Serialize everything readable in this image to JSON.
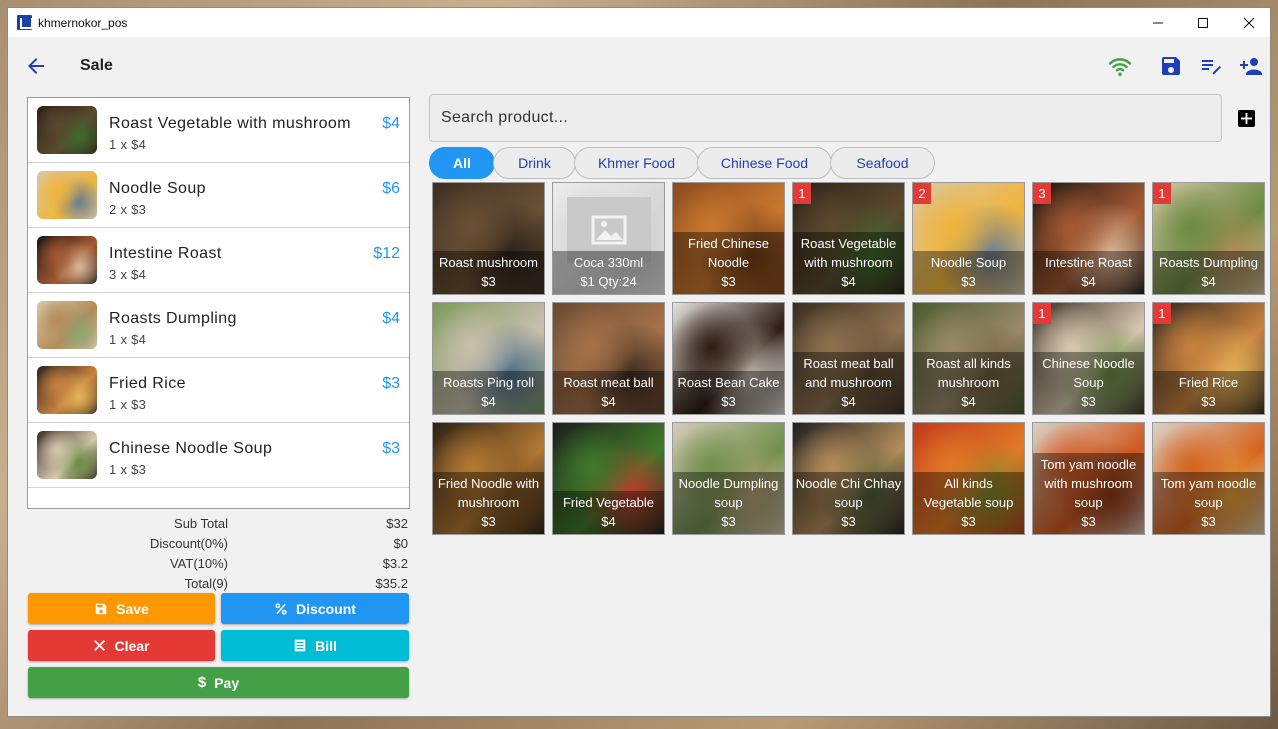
{
  "window": {
    "title": "khmernokor_pos"
  },
  "appbar": {
    "title": "Sale"
  },
  "cart": [
    {
      "name": "Roast Vegetable with mushroom",
      "qty": "1 x $4",
      "total": "$4",
      "colors": [
        "#2b2117",
        "#5c4a2e",
        "#3c6b2d"
      ]
    },
    {
      "name": "Noodle Soup",
      "qty": "2 x $3",
      "total": "$6",
      "colors": [
        "#d8c9a9",
        "#f0b43a",
        "#6a7e8f"
      ]
    },
    {
      "name": "Intestine Roast",
      "qty": "3 x $4",
      "total": "$12",
      "colors": [
        "#181412",
        "#a65a32",
        "#d9b89a"
      ]
    },
    {
      "name": "Roasts Dumpling",
      "qty": "1 x $4",
      "total": "$4",
      "colors": [
        "#d8c7a6",
        "#b48a5a",
        "#89a66c"
      ]
    },
    {
      "name": "Fried Rice",
      "qty": "1 x $3",
      "total": "$3",
      "colors": [
        "#2a2520",
        "#c9823e",
        "#e6b55a"
      ]
    },
    {
      "name": "Chinese Noodle Soup",
      "qty": "1 x $3",
      "total": "$3",
      "colors": [
        "#3a2d22",
        "#d7c9b0",
        "#6a8d43"
      ]
    }
  ],
  "summary": {
    "subtotal_label": "Sub Total",
    "subtotal": "$32",
    "discount_label": "Discount(0%)",
    "discount": "$0",
    "vat_label": "VAT(10%)",
    "vat": "$3.2",
    "total_label": "Total(9)",
    "total": "$35.2"
  },
  "buttons": {
    "save": "Save",
    "discount": "Discount",
    "clear": "Clear",
    "bill": "Bill",
    "pay": "Pay"
  },
  "colors": {
    "save": "#ff9800",
    "discount": "#2196f3",
    "clear": "#e53935",
    "bill": "#00bcd4",
    "pay": "#43a047",
    "accent": "#2196f3",
    "icon_blue": "#1e3fb5",
    "wifi": "#43a047"
  },
  "search": {
    "placeholder": "Search product..."
  },
  "categories": [
    "All",
    "Drink",
    "Khmer Food",
    "Chinese Food",
    "Seafood"
  ],
  "active_category": "All",
  "products": [
    {
      "name": "Roast mushroom",
      "price": "$3",
      "badge": "",
      "colors": [
        "#3d2f22",
        "#6a5034",
        "#2a2119"
      ]
    },
    {
      "name": "Coca 330ml",
      "price": "$1 Qty:24",
      "badge": "",
      "placeholder": true,
      "colors": [
        "#ececec",
        "#d6d6d6",
        "#c9c9c9"
      ]
    },
    {
      "name": "Fried Chinese Noodle",
      "price": "$3",
      "badge": "",
      "colors": [
        "#8a4a1f",
        "#c9782f",
        "#6b3a16"
      ]
    },
    {
      "name": "Roast Vegetable with mushroom",
      "price": "$4",
      "badge": "1",
      "colors": [
        "#2b2117",
        "#5c4a2e",
        "#3c6b2d"
      ]
    },
    {
      "name": "Noodle Soup",
      "price": "$3",
      "badge": "2",
      "colors": [
        "#d8c9a9",
        "#f0b43a",
        "#6a7e8f"
      ]
    },
    {
      "name": "Intestine Roast",
      "price": "$4",
      "badge": "3",
      "colors": [
        "#181412",
        "#a65a32",
        "#d9b89a"
      ]
    },
    {
      "name": "Roasts Dumpling",
      "price": "$4",
      "badge": "1",
      "colors": [
        "#d8c7a6",
        "#6b8a42",
        "#b48a5a"
      ]
    },
    {
      "name": "Roasts Ping roll",
      "price": "$4",
      "badge": "",
      "colors": [
        "#7d9a5a",
        "#c9bfae",
        "#4b6e8a"
      ]
    },
    {
      "name": "Roast meat ball",
      "price": "$4",
      "badge": "",
      "colors": [
        "#6a4a33",
        "#a5724a",
        "#3d2b1f"
      ]
    },
    {
      "name": "Roast Bean Cake",
      "price": "$3",
      "badge": "",
      "colors": [
        "#e6e2dc",
        "#2d1c14",
        "#b9b0a5"
      ]
    },
    {
      "name": "Roast meat ball and mushroom",
      "price": "$4",
      "badge": "",
      "colors": [
        "#3a2c20",
        "#8f7350",
        "#5c4731"
      ]
    },
    {
      "name": "Roast all kinds mushroom",
      "price": "$4",
      "badge": "",
      "colors": [
        "#4a5a2c",
        "#9a8a6a",
        "#6d5d3c"
      ]
    },
    {
      "name": "Chinese Noodle Soup",
      "price": "$3",
      "badge": "1",
      "colors": [
        "#3a2d22",
        "#d7c9b0",
        "#6a8d43"
      ]
    },
    {
      "name": "Fried Rice",
      "price": "$3",
      "badge": "1",
      "colors": [
        "#2a2520",
        "#c9823e",
        "#e6b55a"
      ]
    },
    {
      "name": "Fried Noodle with mushroom",
      "price": "$3",
      "badge": "",
      "colors": [
        "#2b2014",
        "#b57a33",
        "#7a5224"
      ]
    },
    {
      "name": "Fried Vegetable",
      "price": "$4",
      "badge": "",
      "colors": [
        "#1c1c1c",
        "#3f7a2a",
        "#c0392b"
      ]
    },
    {
      "name": "Noodle Dumpling soup",
      "price": "$3",
      "badge": "",
      "colors": [
        "#d6cbb8",
        "#6f8f4a",
        "#b9a27a"
      ]
    },
    {
      "name": "Noodle Chi Chhay soup",
      "price": "$3",
      "badge": "",
      "colors": [
        "#1f1f1f",
        "#b58e5a",
        "#4e5d3a"
      ]
    },
    {
      "name": "All kinds Vegetable soup",
      "price": "$3",
      "badge": "",
      "colors": [
        "#c4381c",
        "#e07a26",
        "#7a8a2a"
      ]
    },
    {
      "name": "Tom yam noodle with mushroom soup",
      "price": "$3",
      "badge": "",
      "colors": [
        "#d8d2c8",
        "#d2581e",
        "#8a3a1a"
      ]
    },
    {
      "name": "Tom yam noodle soup",
      "price": "$3",
      "badge": "",
      "colors": [
        "#d9d2c8",
        "#d6621c",
        "#e3a23b"
      ]
    }
  ]
}
